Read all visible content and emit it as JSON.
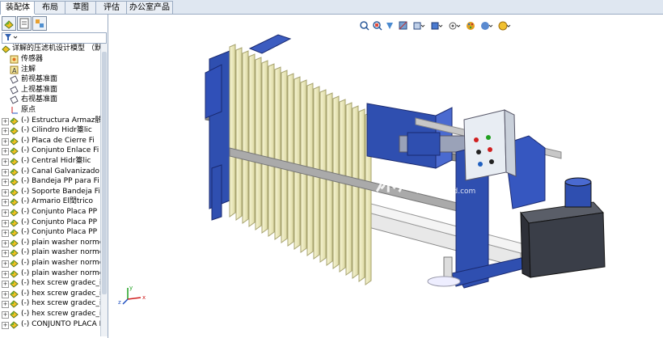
{
  "tabs": [
    "装配体",
    "布局",
    "草图",
    "评估",
    "办公室产品"
  ],
  "active_tab": 0,
  "tree": {
    "root_label": "详解的压滤机设计模型 （默",
    "items": [
      "传感器",
      "注解",
      "前视基准面",
      "上视基准面",
      "右视基准面",
      "原点",
      "(-) Estructura Armaz骸",
      "(-) Cilindro Hidr籉lic",
      "(-) Placa de Cierre Fi",
      "(-) Conjunto Enlace Fi",
      "(-) Central Hidr籉lic",
      "(-) Canal Galvanizado",
      "(-) Bandeja PP para Fi",
      "(-) Soporte Bandeja Fi",
      "(-) Armario El閏trico",
      "(-) Conjunto Placa PP",
      "(-) Conjunto Placa PP",
      "(-) Conjunto Placa PP",
      "(-) plain washer norme",
      "(-) plain washer norme",
      "(-) plain washer norme",
      "(-) plain washer norme",
      "(-) hex screw gradec_i",
      "(-) hex screw gradec_i",
      "(-) hex screw gradec_i",
      "(-) hex screw gradec_i",
      "(-) CONJUNTO PLACA PP"
    ]
  },
  "viewport": {
    "watermark": "沐风网",
    "watermark_sub": "www.mfcad.com"
  },
  "colors": {
    "frame_blue": "#2f4fb0",
    "plate_cream": "#f1efc2",
    "rail_grey": "#9c9c9c",
    "box_dark": "#3a3e48"
  },
  "icons": [
    "zoom-fit-icon",
    "zoom-area-icon",
    "previous-view-icon",
    "section-view-icon",
    "view-orientation-icon",
    "display-style-icon",
    "hide-show-icon",
    "edit-appearance-icon",
    "scene-icon",
    "view-settings-icon"
  ]
}
